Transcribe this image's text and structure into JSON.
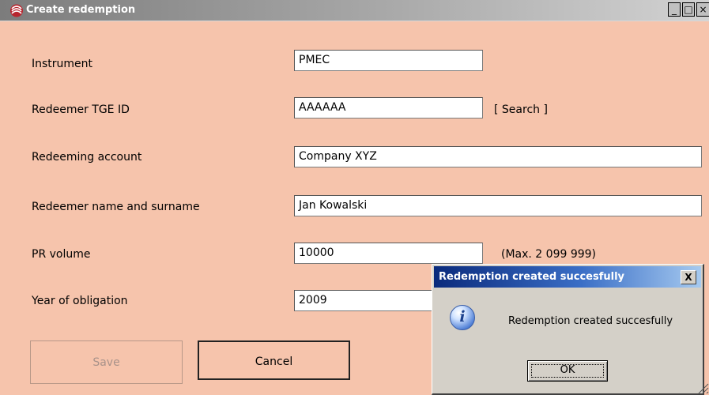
{
  "window": {
    "title": "Create redemption",
    "minimize_glyph": "_",
    "maximize_glyph": "□",
    "close_glyph": "×"
  },
  "form": {
    "instrument": {
      "label": "Instrument",
      "value": "PMEC"
    },
    "redeemer_tge_id": {
      "label": "Redeemer TGE ID",
      "value": "AAAAAA",
      "search_link": "[ Search ]"
    },
    "redeeming_account": {
      "label": "Redeeming account",
      "value": "Company XYZ"
    },
    "redeemer_name": {
      "label": "Redeemer name and surname",
      "value": "Jan Kowalski"
    },
    "pr_volume": {
      "label": "PR volume",
      "value": "10000",
      "hint": "(Max. 2 099 999)"
    },
    "year_of_obligation": {
      "label": "Year of obligation",
      "value": "2009"
    }
  },
  "buttons": {
    "save": "Save",
    "cancel": "Cancel"
  },
  "dialog": {
    "title": "Redemption created succesfully",
    "message": "Redemption created succesfully",
    "ok": "OK",
    "close_glyph": "X",
    "icon": "info-icon"
  },
  "colors": {
    "background": "#f6c4ac",
    "dialog_title": "#0a2a7c",
    "dialog_body": "#d4d0c8"
  }
}
